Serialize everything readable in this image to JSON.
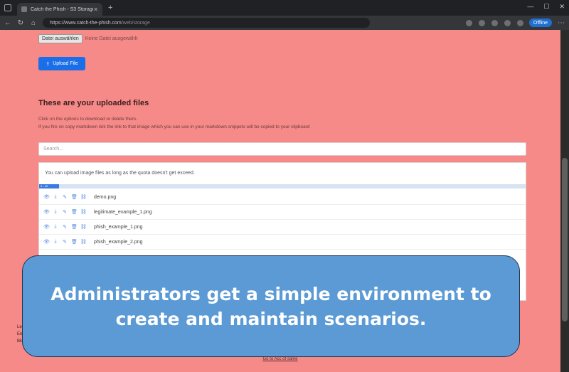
{
  "browser": {
    "tab_title": "Catch the Phish - S3 Storage po",
    "url_host": "https://www.catch-the-phish.com",
    "url_path": "/web/storage",
    "edge_button": "Offline"
  },
  "upload": {
    "choose_label": "Datei auswählen",
    "no_file_label": "Keine Datei ausgewählt",
    "upload_button": "Upload File"
  },
  "files_section": {
    "title": "These are your uploaded files",
    "desc_line1": "Click on the options to download or delete them.",
    "desc_line2": "If you fire on copy markdown link the link to that image which you can use in your markdown snippets will be copied to your clipboard",
    "search_placeholder": "Search...",
    "quota_note": "You can upload image files as long as the quota doesn't get exceed.",
    "selection_chip": "0 - 40",
    "files": [
      {
        "name": "demo.png"
      },
      {
        "name": "legitimate_example_1.png"
      },
      {
        "name": "phish_example_1.png"
      },
      {
        "name": "phish_example_2.png"
      }
    ]
  },
  "left_fragments": [
    "Les",
    "Ent",
    "Bkl"
  ],
  "footer_link": "Go to Acc of same",
  "overlay": {
    "caption": "Administrators get a simple environment to create and maintain scenarios."
  },
  "icons": [
    "view-icon",
    "download-icon",
    "edit-icon",
    "delete-icon",
    "copy-link-icon",
    "upload-icon"
  ]
}
